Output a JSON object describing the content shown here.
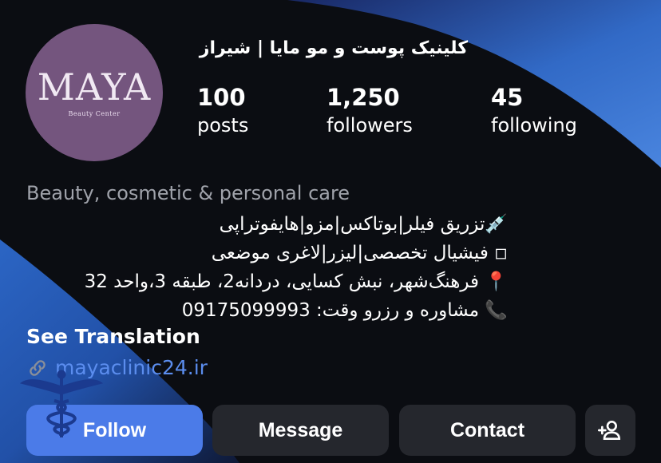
{
  "profile": {
    "name": "کلینیک پوست و مو مایا | شیراز",
    "avatar_logo": "MAYA",
    "avatar_subtitle": "Beauty Center"
  },
  "stats": [
    {
      "count": "100",
      "label": "posts"
    },
    {
      "count": "1,250",
      "label": "followers"
    },
    {
      "count": "45",
      "label": "following"
    }
  ],
  "category": "Beauty, cosmetic & personal care",
  "bio": {
    "line1_emoji": "💉",
    "line1_text": "تزریق فیلر|بوتاکس|مزو|هایفوتراپی",
    "line2_emoji": "◽",
    "line2_text": "فیشیال تخصصی|لیزر|لاغری موضعی",
    "line3_emoji": "📍",
    "line3_text": "فرهنگ‌شهر، نبش کسایی، دردانه2، طبقه 3،واحد 32",
    "line4_emoji": "📞",
    "line4_text": "مشاوره و رزرو وقت: 09175099993"
  },
  "see_translation": "See Translation",
  "link": {
    "icon": "link-icon",
    "text": "mayaclinic24.ir"
  },
  "buttons": {
    "follow": "Follow",
    "message": "Message",
    "contact": "Contact",
    "add_user_icon": "add-user-icon"
  },
  "colors": {
    "background": "#0b0d12",
    "wave_blue": "#3f7fe0",
    "follow_blue": "#4b7be8",
    "link_blue": "#5b8dee",
    "button_gray": "#25272d",
    "avatar_purple": "#74557e"
  }
}
